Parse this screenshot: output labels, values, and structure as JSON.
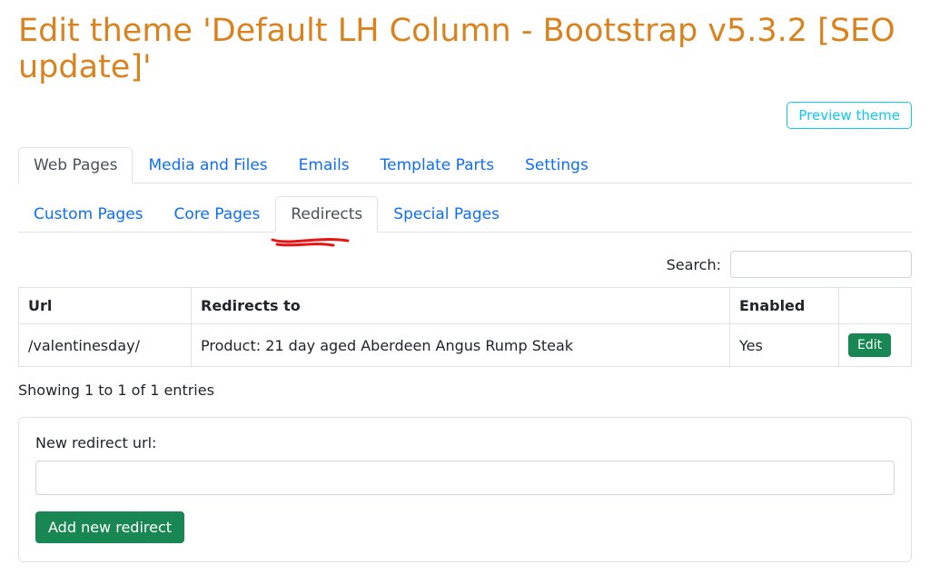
{
  "page": {
    "title": "Edit theme 'Default LH Column - Bootstrap v5.3.2 [SEO update]'",
    "preview_button": "Preview theme"
  },
  "tabs": {
    "primary": [
      "Web Pages",
      "Media and Files",
      "Emails",
      "Template Parts",
      "Settings"
    ],
    "secondary": [
      "Custom Pages",
      "Core Pages",
      "Redirects",
      "Special Pages"
    ]
  },
  "search": {
    "label": "Search:",
    "value": ""
  },
  "table": {
    "headers": {
      "url": "Url",
      "redirects_to": "Redirects to",
      "enabled": "Enabled",
      "actions": ""
    },
    "rows": [
      {
        "url": "/valentinesday/",
        "redirects_to": "Product: 21 day aged Aberdeen Angus Rump Steak",
        "enabled": "Yes",
        "action_label": "Edit"
      }
    ],
    "showing": "Showing 1 to 1 of 1 entries"
  },
  "new_redirect": {
    "label": "New redirect url:",
    "value": "",
    "button": "Add new redirect"
  }
}
